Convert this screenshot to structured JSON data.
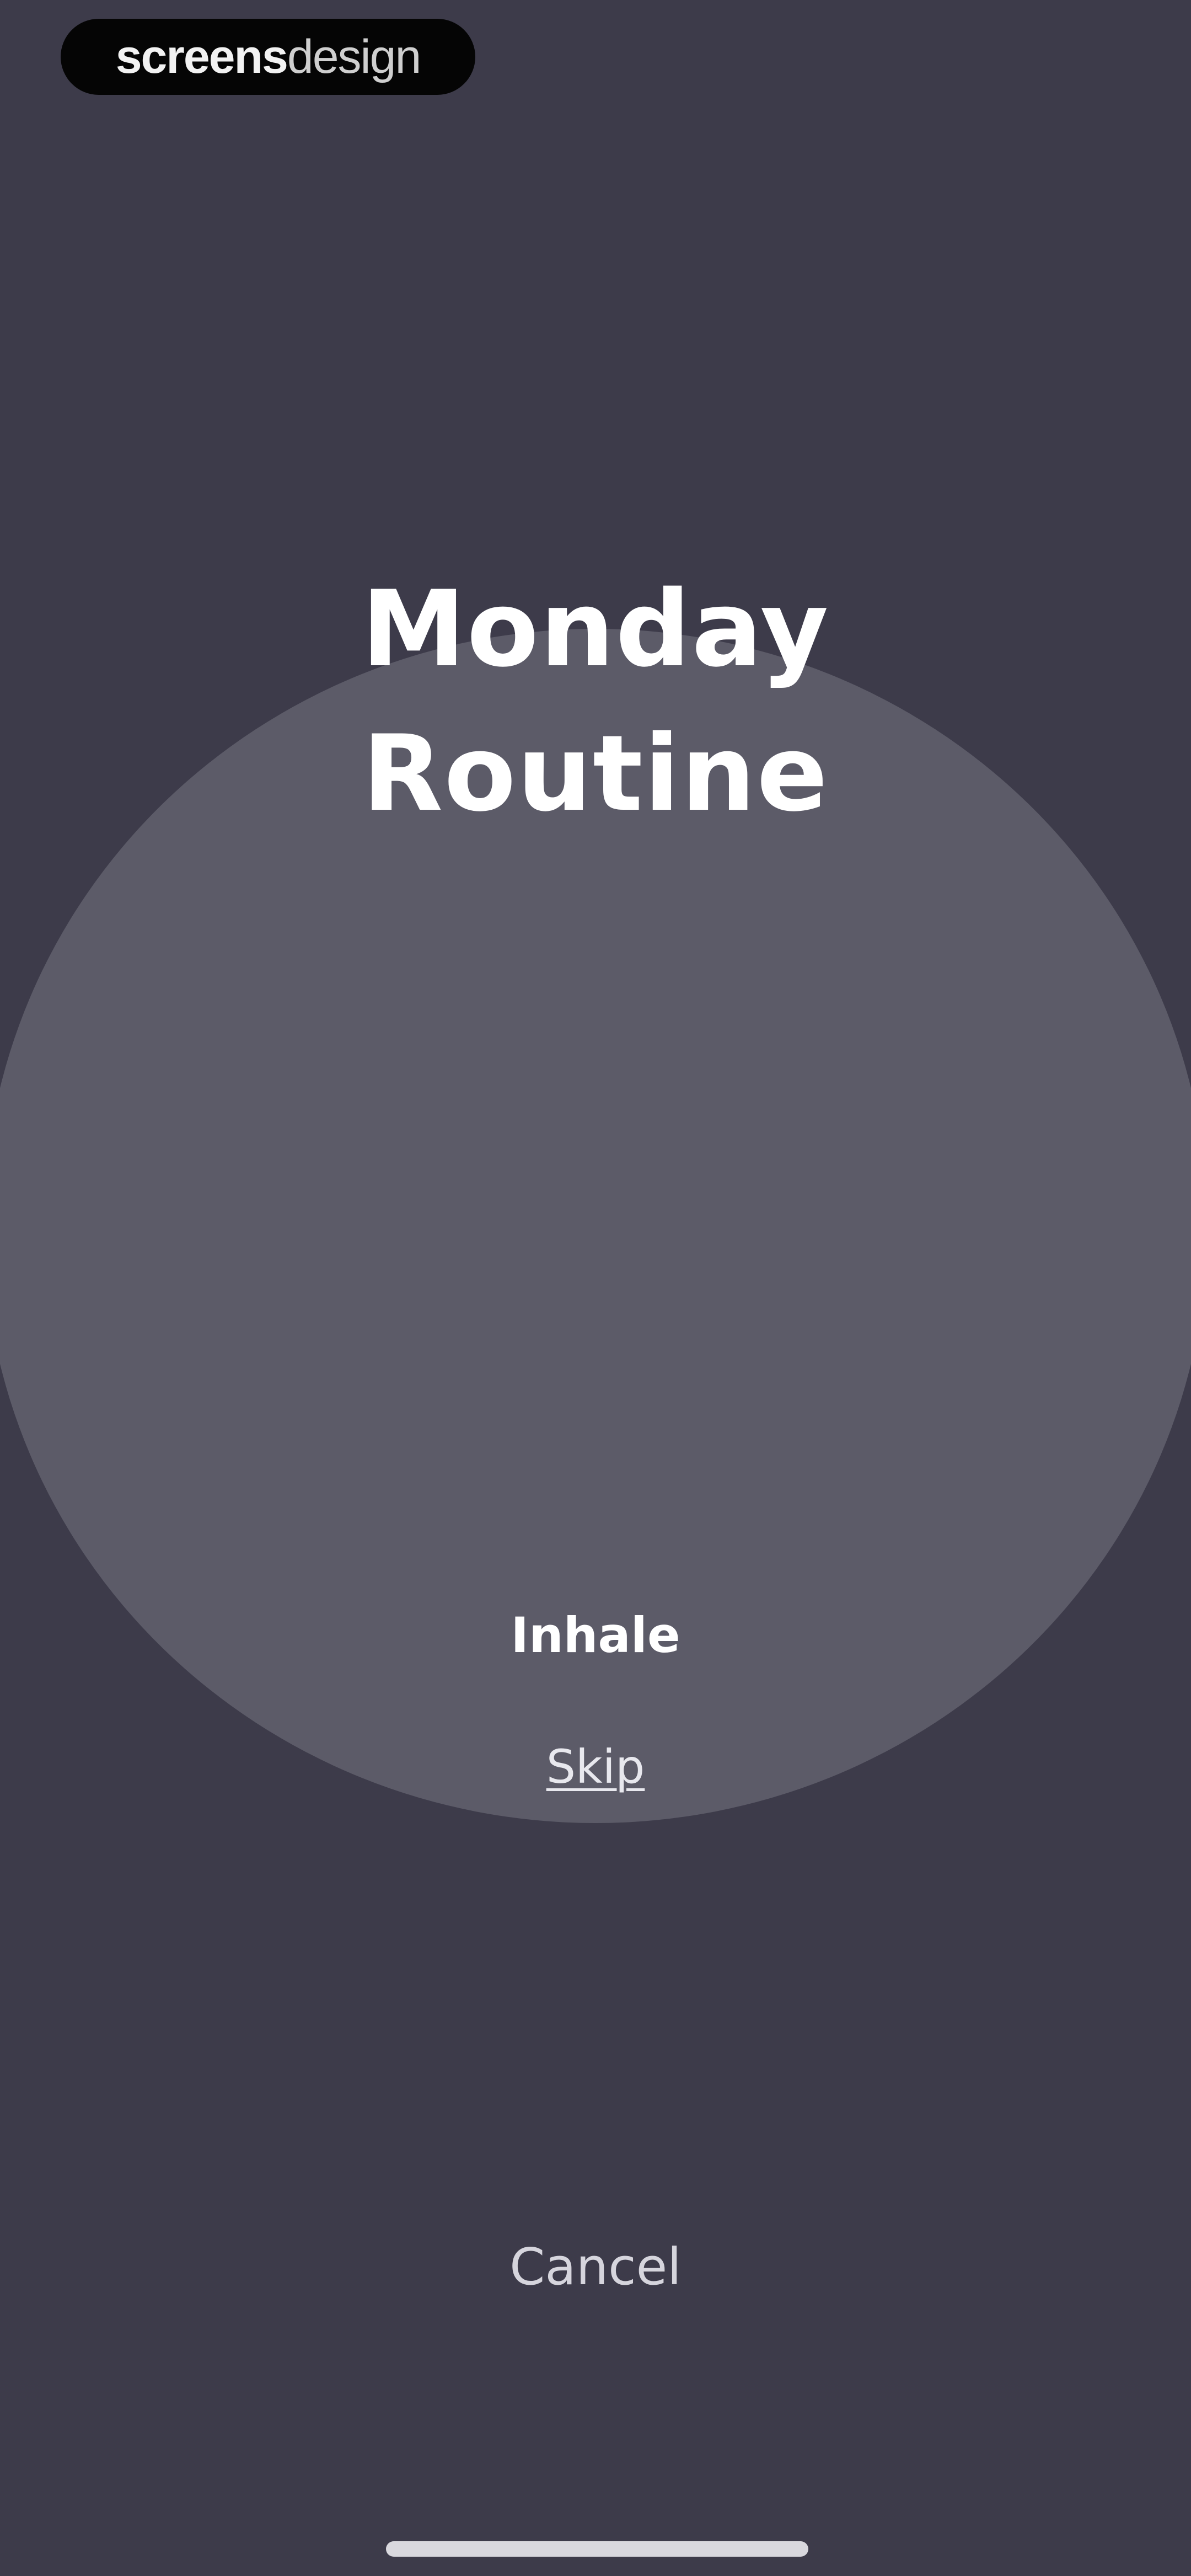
{
  "watermark": {
    "bold_text": "screens",
    "light_text": "design"
  },
  "routine": {
    "title_line1": "Monday",
    "title_line2": "Routine"
  },
  "breathing": {
    "phase": "Inhale",
    "skip_label": "Skip"
  },
  "footer": {
    "cancel_label": "Cancel"
  },
  "colors": {
    "background": "#3d3b4a",
    "circle": "#5c5b68",
    "text": "#ffffff"
  }
}
